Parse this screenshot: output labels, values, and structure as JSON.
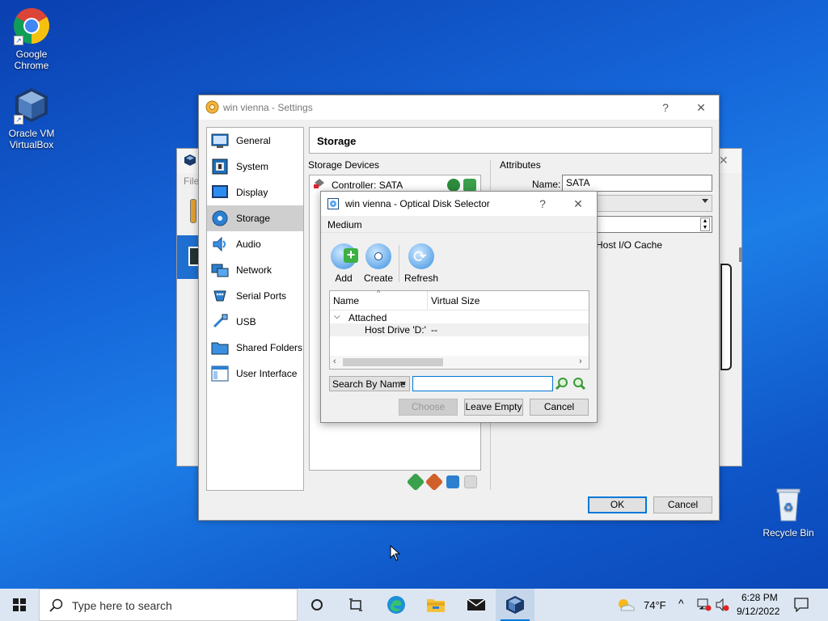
{
  "desktop": {
    "icons": [
      {
        "label_line1": "Google",
        "label_line2": "Chrome",
        "icon": "chrome-icon"
      },
      {
        "label_line1": "Oracle VM",
        "label_line2": "VirtualBox",
        "icon": "virtualbox-icon"
      },
      {
        "label_line1": "Recycle Bin",
        "label_line2": "",
        "icon": "recycle-bin-icon"
      }
    ]
  },
  "manager_window": {
    "menu_text": "File"
  },
  "settings": {
    "title": "win vienna - Settings",
    "help": "?",
    "close": "✕",
    "nav": [
      {
        "label": "General",
        "icon": "general-icon"
      },
      {
        "label": "System",
        "icon": "system-icon"
      },
      {
        "label": "Display",
        "icon": "display-icon"
      },
      {
        "label": "Storage",
        "icon": "storage-icon",
        "selected": true
      },
      {
        "label": "Audio",
        "icon": "audio-icon"
      },
      {
        "label": "Network",
        "icon": "network-icon"
      },
      {
        "label": "Serial Ports",
        "icon": "serial-ports-icon"
      },
      {
        "label": "USB",
        "icon": "usb-icon"
      },
      {
        "label": "Shared Folders",
        "icon": "shared-folders-icon"
      },
      {
        "label": "User Interface",
        "icon": "user-interface-icon"
      }
    ],
    "section_title": "Storage",
    "storage_devices_label": "Storage Devices",
    "controller_label": "Controller: SATA",
    "attributes_label": "Attributes",
    "name_label": "Name:",
    "name_value": "SATA",
    "host_io_cache": "Host I/O Cache",
    "ok": "OK",
    "cancel": "Cancel"
  },
  "optical_dialog": {
    "title": "win vienna - Optical Disk Selector",
    "help": "?",
    "close": "✕",
    "medium_label": "Medium",
    "tools": [
      {
        "label": "Add",
        "icon": "add-disk-icon"
      },
      {
        "label": "Create",
        "icon": "create-disk-icon"
      },
      {
        "label": "Refresh",
        "icon": "refresh-icon"
      }
    ],
    "columns": [
      "Name",
      "Virtual Size"
    ],
    "group_label": "Attached",
    "rows": [
      {
        "name": "Host Drive 'D:'",
        "size": "--"
      }
    ],
    "search_mode": "Search By Name",
    "search_value": "",
    "choose": "Choose",
    "leave_empty": "Leave Empty",
    "cancel": "Cancel"
  },
  "taskbar": {
    "search_placeholder": "Type here to search",
    "weather": "74°F",
    "time": "6:28 PM",
    "date": "9/12/2022"
  }
}
